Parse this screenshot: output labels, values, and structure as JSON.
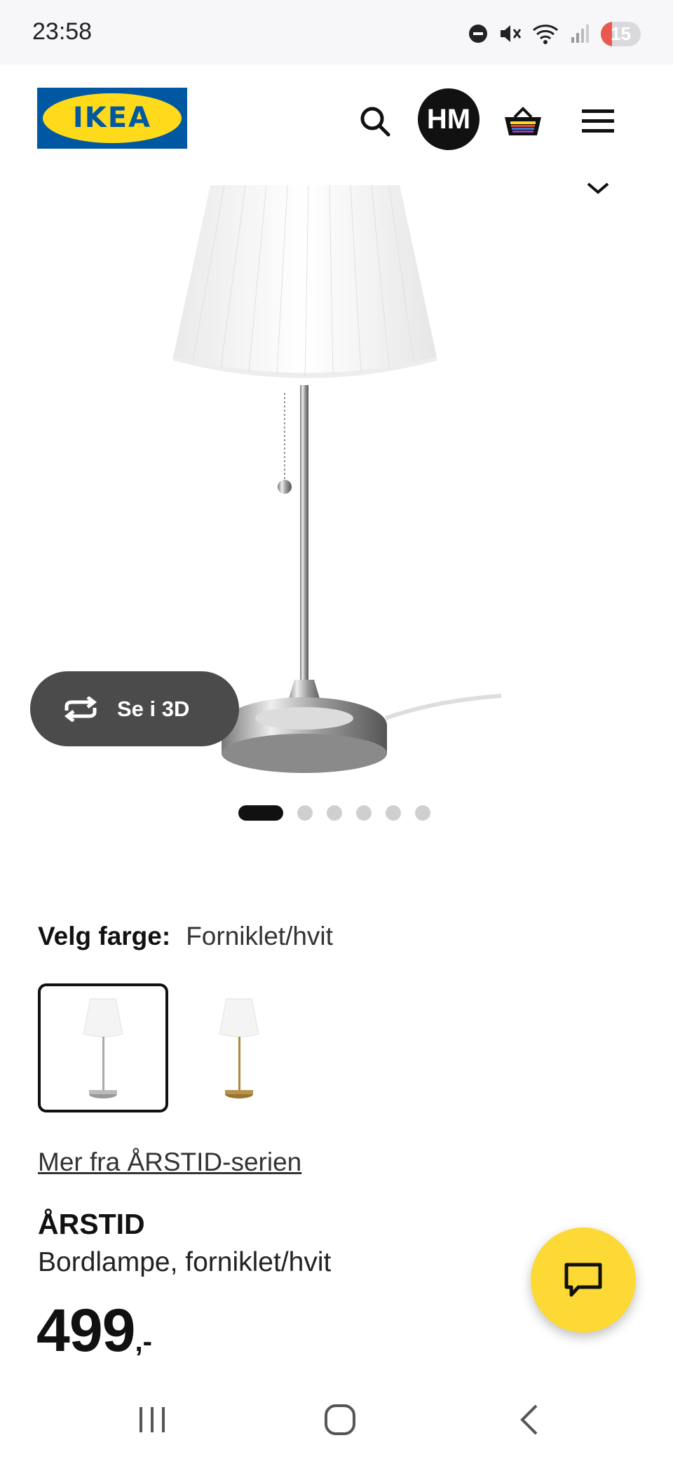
{
  "status_bar": {
    "time": "23:58",
    "battery": "15",
    "icons": [
      "do-not-disturb-icon",
      "mute-icon",
      "wifi-icon",
      "signal-icon"
    ]
  },
  "header": {
    "logo_text": "IKEA",
    "avatar_initials": "HM",
    "icons": [
      "search-icon",
      "basket-icon",
      "menu-icon"
    ]
  },
  "hero": {
    "view_3d_label": "Se i 3D",
    "carousel": {
      "total": 6,
      "active": 1
    }
  },
  "color_picker": {
    "label": "Velg farge:",
    "value": "Forniklet/hvit",
    "options": [
      "nickel-white",
      "brass-white"
    ]
  },
  "product": {
    "series_link": "Mer fra ÅRSTID-serien",
    "name": "ÅRSTID",
    "description": "Bordlampe, forniklet/hvit",
    "price": "499",
    "price_suffix": ",-"
  },
  "colors": {
    "ikea_blue": "#0058a3",
    "ikea_yellow": "#ffda1a",
    "chat_yellow": "#fdd935",
    "pill_dark": "#4b4b4b"
  }
}
